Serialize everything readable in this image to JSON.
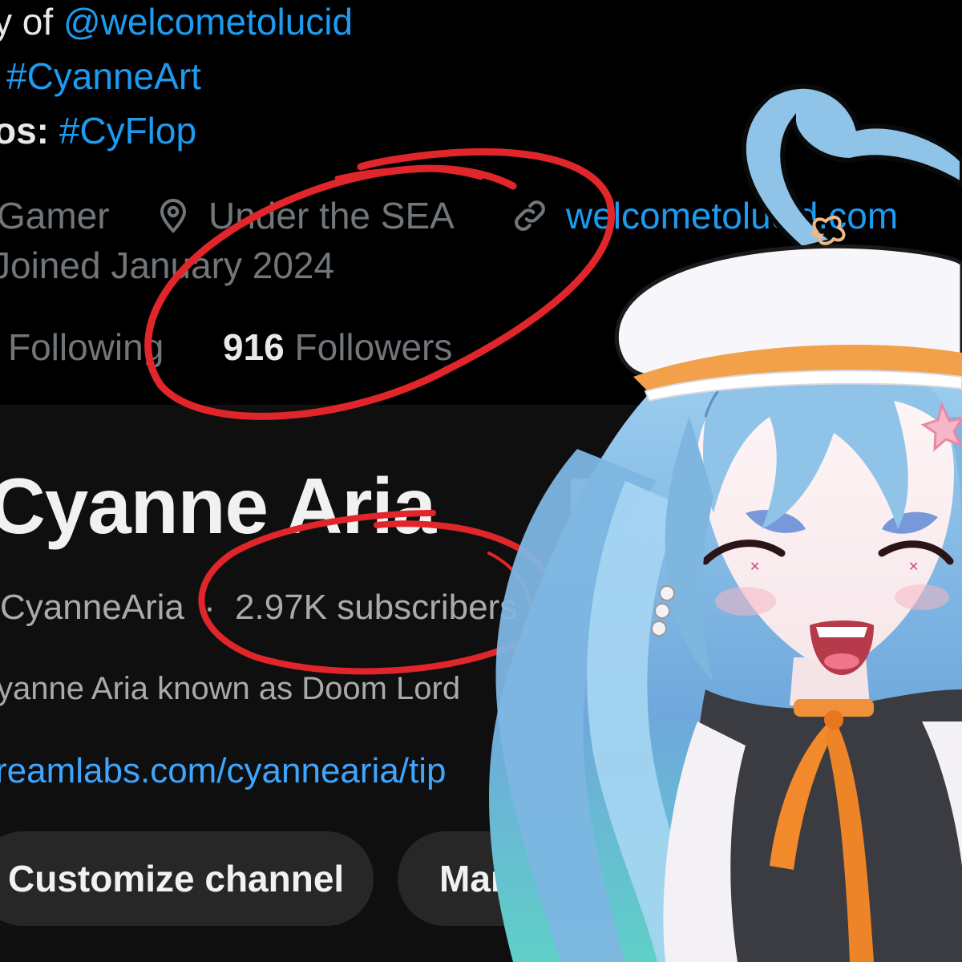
{
  "twitter": {
    "bio": {
      "line1_prefix": "y of",
      "line1_handle": "@welcometolucid",
      "line2_tag": "#CyanneArt",
      "line3_prefix": "os:",
      "line3_tag": "#CyFlop"
    },
    "meta": {
      "category": "Gamer",
      "location": "Under the SEA",
      "website": "welcometolucid.com",
      "joined": "Joined January 2024"
    },
    "stats": {
      "following_label": "Following",
      "followers_count": "916",
      "followers_label": "Followers"
    }
  },
  "youtube": {
    "channel_name": "Cyanne Aria",
    "handle": "CyanneAria",
    "separator": "·",
    "subscribers": "2.97K subscribers",
    "description": "yanne Aria known as Doom Lord",
    "link": "reamlabs.com/cyannearia/tip",
    "buttons": {
      "customize": "Customize channel",
      "manage": "Manage videos"
    }
  },
  "colors": {
    "twitter_bg": "#000000",
    "youtube_bg": "#0f0f0f",
    "link_blue": "#1d9bf0",
    "annotation_red": "#e0262b",
    "character_hair": "#8fc3e8"
  },
  "icons": [
    "location-pin-icon",
    "link-icon"
  ]
}
